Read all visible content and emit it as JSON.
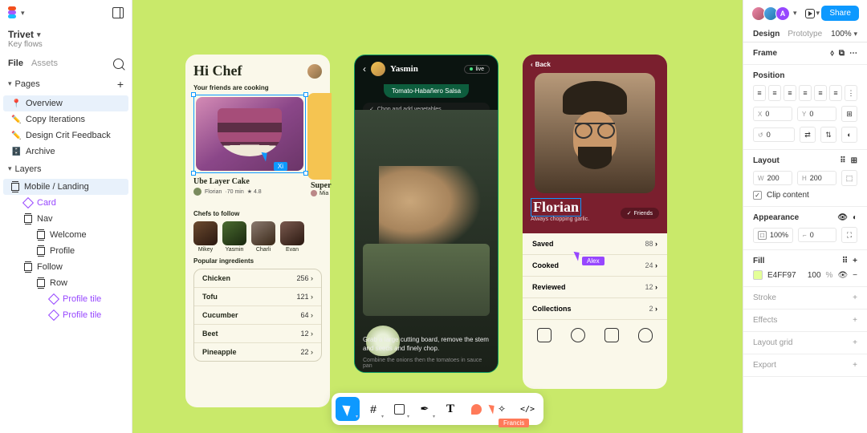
{
  "project": {
    "name": "Trivet",
    "subtitle": "Key flows"
  },
  "left_tabs": {
    "file": "File",
    "assets": "Assets"
  },
  "pages": {
    "header": "Pages",
    "items": [
      {
        "icon": "📍",
        "label": "Overview",
        "active": true
      },
      {
        "icon": "✏️",
        "label": "Copy Iterations"
      },
      {
        "icon": "✏️",
        "label": "Design Crit Feedback"
      },
      {
        "icon": "🗄️",
        "label": "Archive"
      }
    ]
  },
  "layers": {
    "header": "Layers",
    "items": [
      {
        "label": "Mobile / Landing",
        "depth": 0,
        "type": "frame",
        "active": true
      },
      {
        "label": "Card",
        "depth": 1,
        "type": "component"
      },
      {
        "label": "Nav",
        "depth": 1,
        "type": "frame"
      },
      {
        "label": "Welcome",
        "depth": 2,
        "type": "frame"
      },
      {
        "label": "Profile",
        "depth": 2,
        "type": "frame"
      },
      {
        "label": "Follow",
        "depth": 1,
        "type": "frame"
      },
      {
        "label": "Row",
        "depth": 2,
        "type": "frame"
      },
      {
        "label": "Profile tile",
        "depth": 3,
        "type": "component"
      },
      {
        "label": "Profile tile",
        "depth": 3,
        "type": "component"
      }
    ]
  },
  "cursors": {
    "xi": "Xi",
    "alex": "Alex",
    "francis": "Francis"
  },
  "frame_a": {
    "greeting": "Hi Chef",
    "friends_cooking": "Your friends are cooking",
    "card_title": "Ube Layer Cake",
    "card_author": "Florian",
    "card_time": "·70 min",
    "card_rating": "★ 4.8",
    "side_title": "Super",
    "side_author": "Mia",
    "chefs_header": "Chefs to follow",
    "chefs": [
      "Mikey",
      "Yasmin",
      "Charli",
      "Evan"
    ],
    "ingredients_header": "Popular ingredients",
    "ingredients": [
      {
        "name": "Chicken",
        "count": "256"
      },
      {
        "name": "Tofu",
        "count": "121"
      },
      {
        "name": "Cucumber",
        "count": "64"
      },
      {
        "name": "Beet",
        "count": "12"
      },
      {
        "name": "Pineapple",
        "count": "22"
      }
    ]
  },
  "frame_b": {
    "name": "Yasmin",
    "live": "live",
    "recipe": "Tomato-Habañero Salsa",
    "step": "Chop and add vegetables",
    "caption": "Grab a large cutting board, remove the stem and seeds and finely chop.",
    "caption2": "Combine the onions then the tomatoes in sauce pan"
  },
  "frame_c": {
    "back": "Back",
    "name": "Florian",
    "sub": "Always chopping garlic.",
    "friends": "Friends",
    "stats": [
      {
        "label": "Saved",
        "value": "88"
      },
      {
        "label": "Cooked",
        "value": "24"
      },
      {
        "label": "Reviewed",
        "value": "12"
      },
      {
        "label": "Collections",
        "value": "2"
      }
    ]
  },
  "right": {
    "share": "Share",
    "tabs": {
      "design": "Design",
      "prototype": "Prototype"
    },
    "zoom": "100%",
    "frame_label": "Frame",
    "position_label": "Position",
    "x": "0",
    "y": "0",
    "rotate": "0",
    "layout_label": "Layout",
    "w": "200",
    "h": "200",
    "clip": "Clip content",
    "appearance_label": "Appearance",
    "opacity": "100%",
    "corner": "0",
    "fill_label": "Fill",
    "fill_hex": "E4FF97",
    "fill_pct": "100",
    "pct_unit": "%",
    "stroke": "Stroke",
    "effects": "Effects",
    "layout_grid": "Layout grid",
    "export": "Export"
  },
  "colors": {
    "canvas": "#c9e96a",
    "accent": "#0d99ff",
    "fill_swatch": "#e4ff97"
  }
}
